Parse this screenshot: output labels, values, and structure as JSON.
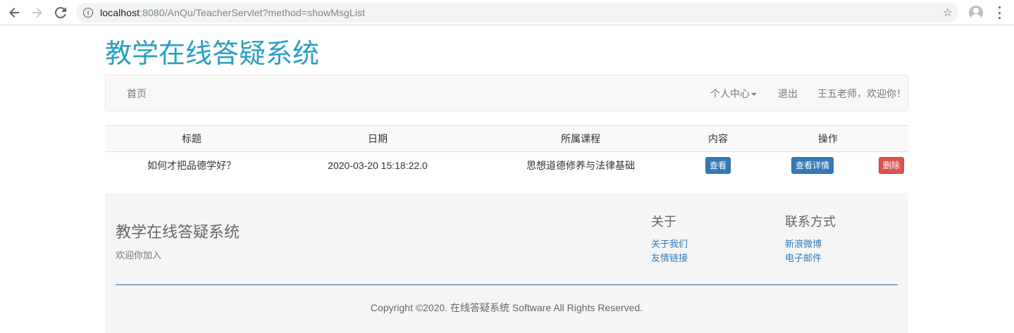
{
  "browser": {
    "url_host": "localhost",
    "url_path": ":8080/AnQu/TeacherServlet?method=showMsgList"
  },
  "site": {
    "title": "教学在线答疑系统"
  },
  "navbar": {
    "home": "首页",
    "personal_center": "个人中心",
    "logout": "退出",
    "welcome": "王五老师，欢迎你！"
  },
  "table": {
    "headers": [
      "标题",
      "日期",
      "所属课程",
      "内容",
      "操作"
    ],
    "rows": [
      {
        "title": "如何才把品德学好？",
        "date": "2020-03-20 15:18:22.0",
        "course": "思想道德修养与法律基础",
        "view_label": "查看",
        "detail_label": "查看详情",
        "delete_label": "删除"
      }
    ]
  },
  "footer": {
    "title": "教学在线答疑系统",
    "subtitle": "欢迎你加入",
    "about": {
      "heading": "关于",
      "links": [
        "关于我们",
        "友情链接"
      ]
    },
    "contact": {
      "heading": "联系方式",
      "links": [
        "新浪微博",
        "电子邮件"
      ]
    },
    "copyright": "Copyright ©2020. 在线答疑系统 Software All Rights Reserved."
  },
  "colors": {
    "brand": "#2a9fc4",
    "primary_button": "#337ab7",
    "danger_button": "#d9534f"
  }
}
